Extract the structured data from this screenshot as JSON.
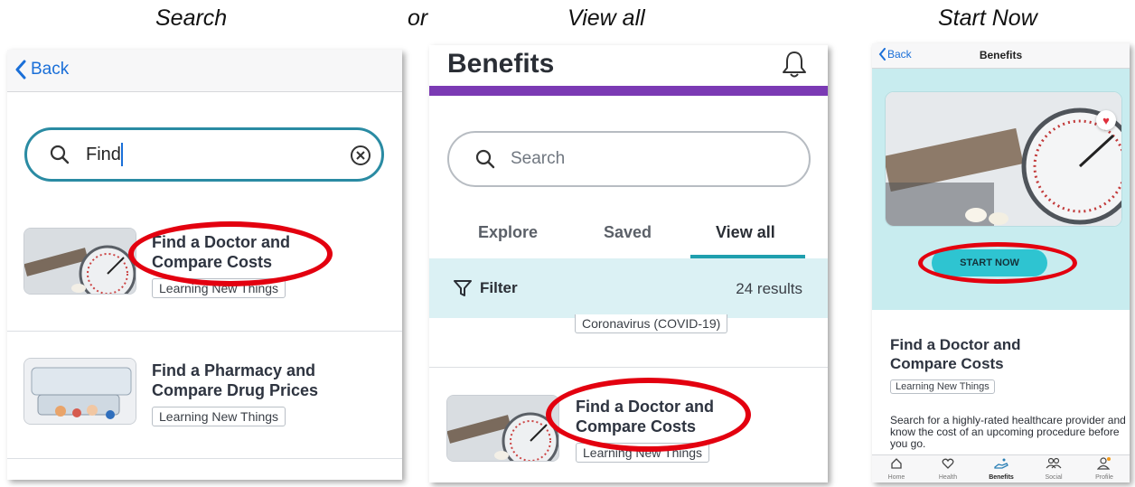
{
  "captions": {
    "left": "Search",
    "middle": "or",
    "center": "View all",
    "right": "Start Now"
  },
  "panel1": {
    "back_label": "Back",
    "search_value": "Find",
    "results": [
      {
        "title_line1": "Find a Doctor and",
        "title_line2": "Compare Costs",
        "tag": "Learning New Things"
      },
      {
        "title_line1": "Find a Pharmacy and",
        "title_line2": "Compare Drug Prices",
        "tag": "Learning New Things"
      }
    ]
  },
  "panel2": {
    "title": "Benefits",
    "search_placeholder": "Search",
    "tabs": [
      "Explore",
      "Saved",
      "View all"
    ],
    "filter_label": "Filter",
    "results_count": "24 results",
    "partial_tag": "Coronavirus (COVID-19)",
    "item": {
      "title_line1": "Find a Doctor and",
      "title_line2": "Compare Costs",
      "tag": "Learning New Things"
    }
  },
  "panel3": {
    "back_label": "Back",
    "title": "Benefits",
    "start_button": "START NOW",
    "heading_line1": "Find a Doctor and",
    "heading_line2": "Compare Costs",
    "tag": "Learning New Things",
    "description": "Search for a highly-rated healthcare provider and know the cost of an upcoming procedure before you go.",
    "nav": [
      "Home",
      "Health",
      "Benefits",
      "Social",
      "Profile"
    ]
  },
  "colors": {
    "accent_blue": "#1a6fd8",
    "purple_bar": "#7b3ab4",
    "teal_bg": "#c8ecef",
    "filter_bg": "#dbf1f4",
    "teal_button": "#2ec4d1",
    "highlight_red": "#e3000f"
  }
}
